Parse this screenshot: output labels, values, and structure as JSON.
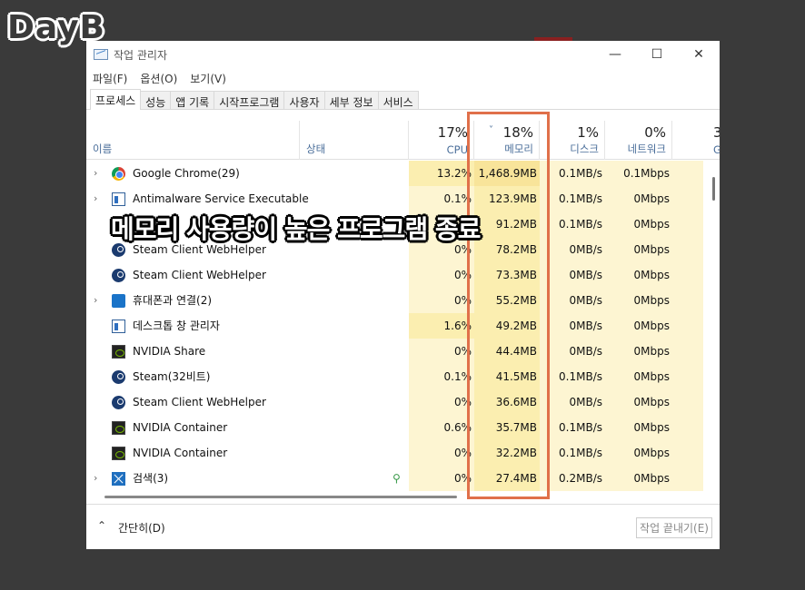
{
  "logo_text": "DayB",
  "window": {
    "title": "작업 관리자",
    "controls": {
      "minimize": "—",
      "maximize": "☐",
      "close": "✕"
    }
  },
  "menu": [
    "파일(F)",
    "옵션(O)",
    "보기(V)"
  ],
  "tabs": [
    "프로세스",
    "성능",
    "앱 기록",
    "시작프로그램",
    "사용자",
    "세부 정보",
    "서비스"
  ],
  "header": {
    "name": "이름",
    "status": "상태",
    "cpu": {
      "pct": "17%",
      "label": "CPU"
    },
    "memory": {
      "pct": "18%",
      "label": "메모리",
      "sort_icon": "˅"
    },
    "disk": {
      "pct": "1%",
      "label": "디스크"
    },
    "network": {
      "pct": "0%",
      "label": "네트워크"
    },
    "gpu": {
      "pct": "3",
      "label": "G"
    }
  },
  "processes": [
    {
      "name": "Google Chrome(29)",
      "icon": "chrome-icon",
      "expand": "›",
      "status": "",
      "cpu": "13.2%",
      "mem": "1,468.9MB",
      "disk": "0.1MB/s",
      "net": "0.1Mbps"
    },
    {
      "name": "Antimalware Service Executable",
      "icon": "window-icon",
      "expand": "›",
      "status": "",
      "cpu": "0.1%",
      "mem": "123.9MB",
      "disk": "0.1MB/s",
      "net": "0Mbps"
    },
    {
      "name": "",
      "icon": "steam-icon",
      "expand": "",
      "status": "",
      "cpu": "0%",
      "mem": "91.2MB",
      "disk": "0.1MB/s",
      "net": "0Mbps"
    },
    {
      "name": "Steam Client WebHelper",
      "icon": "steam-icon",
      "expand": "",
      "status": "",
      "cpu": "0%",
      "mem": "78.2MB",
      "disk": "0MB/s",
      "net": "0Mbps"
    },
    {
      "name": "Steam Client WebHelper",
      "icon": "steam-icon",
      "expand": "",
      "status": "",
      "cpu": "0%",
      "mem": "73.3MB",
      "disk": "0MB/s",
      "net": "0Mbps"
    },
    {
      "name": "휴대폰과 연결(2)",
      "icon": "phone-icon",
      "expand": "›",
      "status": "",
      "cpu": "0%",
      "mem": "55.2MB",
      "disk": "0MB/s",
      "net": "0Mbps"
    },
    {
      "name": "데스크톱 창 관리자",
      "icon": "window-icon",
      "expand": "",
      "status": "",
      "cpu": "1.6%",
      "mem": "49.2MB",
      "disk": "0MB/s",
      "net": "0Mbps"
    },
    {
      "name": "NVIDIA Share",
      "icon": "nvidia-icon",
      "expand": "",
      "status": "",
      "cpu": "0%",
      "mem": "44.4MB",
      "disk": "0MB/s",
      "net": "0Mbps"
    },
    {
      "name": "Steam(32비트)",
      "icon": "steam-icon",
      "expand": "",
      "status": "",
      "cpu": "0.1%",
      "mem": "41.5MB",
      "disk": "0.1MB/s",
      "net": "0Mbps"
    },
    {
      "name": "Steam Client WebHelper",
      "icon": "steam-icon",
      "expand": "",
      "status": "",
      "cpu": "0%",
      "mem": "36.6MB",
      "disk": "0MB/s",
      "net": "0Mbps"
    },
    {
      "name": "NVIDIA Container",
      "icon": "nvidia-icon",
      "expand": "",
      "status": "",
      "cpu": "0.6%",
      "mem": "35.7MB",
      "disk": "0.1MB/s",
      "net": "0Mbps"
    },
    {
      "name": "NVIDIA Container",
      "icon": "nvidia-icon",
      "expand": "",
      "status": "",
      "cpu": "0%",
      "mem": "32.2MB",
      "disk": "0.1MB/s",
      "net": "0Mbps"
    },
    {
      "name": "검색(3)",
      "icon": "search-app-icon",
      "expand": "›",
      "status": "leaf",
      "cpu": "0%",
      "mem": "27.4MB",
      "disk": "0.2MB/s",
      "net": "0Mbps"
    }
  ],
  "footer": {
    "chevron": "⌃",
    "fewer_details": "간단히(D)",
    "end_task": "작업 끝내기(E)"
  },
  "overlay_caption": "메모리 사용량이 높은 프로그램 종료",
  "colors": {
    "highlight_border": "#e0704a",
    "cell_light": "#fdf5d2",
    "cell_medium": "#fbeeb0",
    "cell_strong": "#f8e49a"
  }
}
